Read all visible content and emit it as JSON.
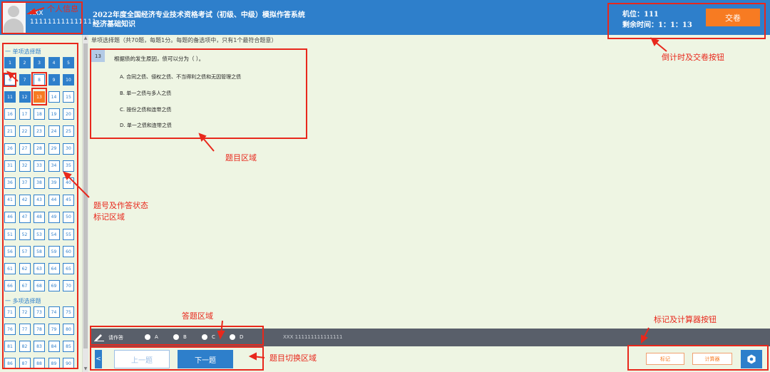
{
  "header": {
    "user_name": "XXX",
    "user_id": "111111111111111",
    "exam_title": "2022年度全国经济专业技术资格考试（初级、中级）模拟作答系统",
    "exam_subject": "经济基础知识",
    "seat": "机位：111",
    "time_remaining": "剩余时间：1：1：13",
    "submit_label": "交卷"
  },
  "sidebar": {
    "single_section": "一  单项选择题",
    "multi_section": "一  多项选择题",
    "single_numbers": [
      "1",
      "2",
      "3",
      "4",
      "5",
      "6",
      "7",
      "8",
      "9",
      "10",
      "11",
      "12",
      "13",
      "14",
      "15",
      "16",
      "17",
      "18",
      "19",
      "20",
      "21",
      "22",
      "23",
      "24",
      "25",
      "26",
      "27",
      "28",
      "29",
      "30",
      "31",
      "32",
      "33",
      "34",
      "35",
      "36",
      "37",
      "38",
      "39",
      "40",
      "41",
      "42",
      "43",
      "44",
      "45",
      "46",
      "47",
      "48",
      "49",
      "50",
      "51",
      "52",
      "53",
      "54",
      "55",
      "56",
      "57",
      "58",
      "59",
      "60",
      "61",
      "62",
      "63",
      "64",
      "65",
      "66",
      "67",
      "68",
      "69",
      "70"
    ],
    "multi_numbers": [
      "71",
      "72",
      "73",
      "74",
      "75",
      "76",
      "77",
      "78",
      "79",
      "80",
      "81",
      "82",
      "83",
      "84",
      "85",
      "86",
      "87",
      "88",
      "89",
      "90"
    ],
    "answered": [
      1,
      2,
      3,
      4,
      5,
      7,
      9,
      10,
      11,
      12
    ],
    "current": 13
  },
  "question": {
    "instructions": "单项选择题（共70题，每题1分。每题的备选项中，只有1个最符合题意）",
    "number": "13",
    "stem": "根据债的发生原因，债可以分为（ ）。",
    "options": [
      "A. 合同之债、侵权之债、不当得利之债和无因管理之债",
      "B. 单一之债与多人之债",
      "C. 按份之债和连带之债",
      "D. 单一之债和连带之债"
    ]
  },
  "answer_bar": {
    "label": "请作答",
    "choices": [
      "A",
      "B",
      "C",
      "D"
    ],
    "footer_id": "XXX 111111111111111"
  },
  "nav": {
    "collapse": "<",
    "prev": "上一题",
    "next": "下一题",
    "mark": "标记",
    "calculator": "计算器"
  },
  "annotations": {
    "personal_info": "个人信息",
    "countdown_submit": "倒计时及交卷按钮",
    "question_area": "题目区域",
    "question_nav_status": [
      "题号及作答状态",
      "标记区域"
    ],
    "answer_area": "答题区域",
    "switch_area": "题目切换区域",
    "mark_calc": "标记及计算器按钮"
  },
  "colors": {
    "primary": "#2e7fcb",
    "accent": "#f77b22",
    "background": "#eef5e3",
    "annotation": "#e8281c"
  }
}
